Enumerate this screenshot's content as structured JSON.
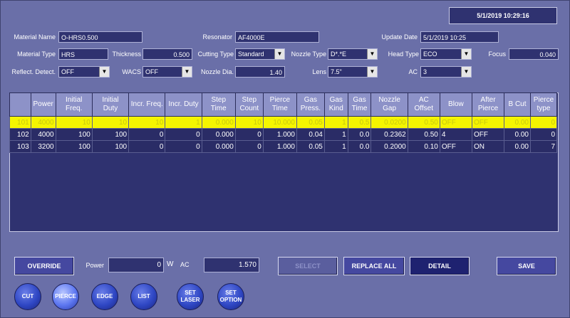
{
  "datetime": "5/1/2019 10:29:16",
  "fields": {
    "material_name": {
      "label": "Material Name",
      "value": "O-HRS0.500"
    },
    "resonator": {
      "label": "Resonator",
      "value": "AF4000E"
    },
    "update_date": {
      "label": "Update Date",
      "value": "5/1/2019 10:25"
    },
    "material_type": {
      "label": "Material Type",
      "value": "HRS"
    },
    "thickness": {
      "label": "Thickness",
      "value": "0.500"
    },
    "cutting_type": {
      "label": "Cutting Type",
      "value": "Standard"
    },
    "nozzle_type": {
      "label": "Nozzle Type",
      "value": "D*.*E"
    },
    "head_type": {
      "label": "Head Type",
      "value": "ECO"
    },
    "focus": {
      "label": "Focus",
      "value": "0.040"
    },
    "reflect_detect": {
      "label": "Reflect. Detect.",
      "value": "OFF"
    },
    "wacs": {
      "label": "WACS",
      "value": "OFF"
    },
    "nozzle_dia": {
      "label": "Nozzle Dia.",
      "value": "1.40"
    },
    "lens": {
      "label": "Lens",
      "value": "7.5\""
    },
    "ac": {
      "label": "AC",
      "value": "3"
    }
  },
  "table": {
    "headers": [
      "",
      "Power",
      "Initial Freq.",
      "Initial Duty",
      "Incr. Freq.",
      "Incr. Duty",
      "Step Time",
      "Step Count",
      "Pierce Time",
      "Gas Press.",
      "Gas Kind",
      "Gas Time",
      "Nozzle Gap",
      "AC Offset",
      "Blow",
      "After Pierce",
      "B Cut",
      "Pierce type"
    ],
    "rows": [
      [
        "101",
        "4000",
        "10",
        "10",
        "10",
        "1",
        "0.000",
        "10",
        "10.000",
        "0.05",
        "1",
        "0.5",
        "0.0200",
        "0.50",
        "OFF",
        "OFF",
        "0.00",
        "0"
      ],
      [
        "102",
        "4000",
        "100",
        "100",
        "0",
        "0",
        "0.000",
        "0",
        "1.000",
        "0.04",
        "1",
        "0.0",
        "0.2362",
        "0.50",
        "4",
        "OFF",
        "0.00",
        "0"
      ],
      [
        "103",
        "3200",
        "100",
        "100",
        "0",
        "0",
        "0.000",
        "0",
        "1.000",
        "0.05",
        "1",
        "0.0",
        "0.2000",
        "0.10",
        "OFF",
        "ON",
        "0.00",
        "7"
      ]
    ],
    "selected_row": 0
  },
  "bottom": {
    "override": "OVERRIDE",
    "power_label": "Power",
    "power_value": "0",
    "power_unit": "W",
    "ac_label": "AC",
    "ac_value": "1.570",
    "select": "SELECT",
    "replace_all": "REPLACE ALL",
    "detail": "DETAIL",
    "save": "SAVE"
  },
  "round_buttons": [
    {
      "l1": "CUT",
      "l2": ""
    },
    {
      "l1": "PIERCE",
      "l2": ""
    },
    {
      "l1": "EDGE",
      "l2": ""
    },
    {
      "l1": "LIST",
      "l2": ""
    },
    {
      "l1": "SET",
      "l2": "LASER"
    },
    {
      "l1": "SET",
      "l2": "OPTION"
    }
  ],
  "colors": {
    "background": "#6a6fa8",
    "field": "#2f3270",
    "selected_row": "#f5f500"
  }
}
